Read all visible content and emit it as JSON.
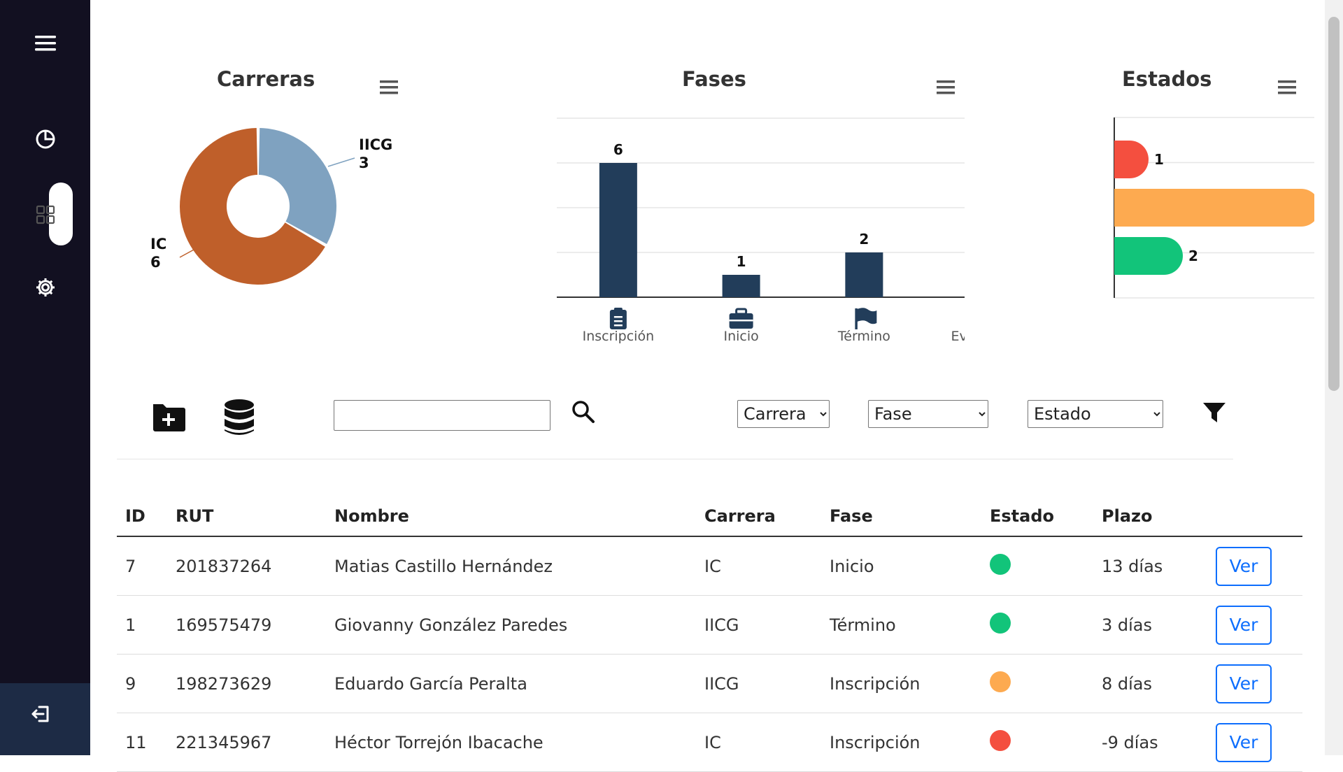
{
  "sidebar": {
    "items": [
      {
        "icon": "hamburger-menu-icon"
      },
      {
        "icon": "pie-chart-icon"
      },
      {
        "icon": "grid-icon",
        "active": true
      },
      {
        "icon": "gear-icon"
      }
    ],
    "logout_icon": "logout-icon"
  },
  "charts": {
    "carreras": {
      "title": "Carreras",
      "menu_icon": "hamburger-menu-icon"
    },
    "fases": {
      "title": "Fases",
      "menu_icon": "hamburger-menu-icon"
    },
    "estados": {
      "title": "Estados",
      "menu_icon": "hamburger-menu-icon"
    }
  },
  "chart_data": [
    {
      "type": "pie",
      "title": "Carreras",
      "categories": [
        "IICG",
        "IC"
      ],
      "values": [
        3,
        6
      ],
      "colors": [
        "#7fa2c0",
        "#bf5f2a"
      ]
    },
    {
      "type": "bar",
      "title": "Fases",
      "categories": [
        "Inscripción",
        "Inicio",
        "Término",
        "Evaluación"
      ],
      "category_icons": [
        "clipboard-icon",
        "briefcase-icon",
        "flag-icon",
        "eye-icon"
      ],
      "values": [
        6,
        1,
        2,
        0
      ],
      "ylim": [
        0,
        8
      ],
      "grid": true,
      "color": "#223d5a"
    },
    {
      "type": "bar",
      "orientation": "horizontal",
      "title": "Estados",
      "values": [
        1,
        6,
        2
      ],
      "colors": [
        "#f44f3f",
        "#fdaa50",
        "#12c47a"
      ],
      "grid": true
    }
  ],
  "toolbar": {
    "add_icon": "folder-plus-icon",
    "db_icon": "database-icon",
    "search_value": "",
    "search_icon": "search-icon",
    "filter_icon": "filter-icon",
    "carrera_select": "Carrera",
    "fase_select": "Fase",
    "estado_select": "Estado"
  },
  "colors": {
    "sidebar": "#121021",
    "estado_verde": "#12c47a",
    "estado_naranja": "#fdaa50",
    "estado_rojo": "#f44f3f",
    "accent": "#0d6efd"
  },
  "table": {
    "headers": [
      "ID",
      "RUT",
      "Nombre",
      "Carrera",
      "Fase",
      "Estado",
      "Plazo"
    ],
    "rows": [
      {
        "id": "7",
        "rut": "201837264",
        "nombre": "Matias Castillo Hernández",
        "carrera": "IC",
        "fase": "Inicio",
        "estado_color": "#12c47a",
        "plazo": "13 días",
        "action": "Ver"
      },
      {
        "id": "1",
        "rut": "169575479",
        "nombre": "Giovanny González Paredes",
        "carrera": "IICG",
        "fase": "Término",
        "estado_color": "#12c47a",
        "plazo": "3 días",
        "action": "Ver"
      },
      {
        "id": "9",
        "rut": "198273629",
        "nombre": "Eduardo García Peralta",
        "carrera": "IICG",
        "fase": "Inscripción",
        "estado_color": "#fdaa50",
        "plazo": "8 días",
        "action": "Ver"
      },
      {
        "id": "11",
        "rut": "221345967",
        "nombre": "Héctor Torrejón Ibacache",
        "carrera": "IC",
        "fase": "Inscripción",
        "estado_color": "#f44f3f",
        "plazo": "-9 días",
        "action": "Ver"
      }
    ]
  }
}
